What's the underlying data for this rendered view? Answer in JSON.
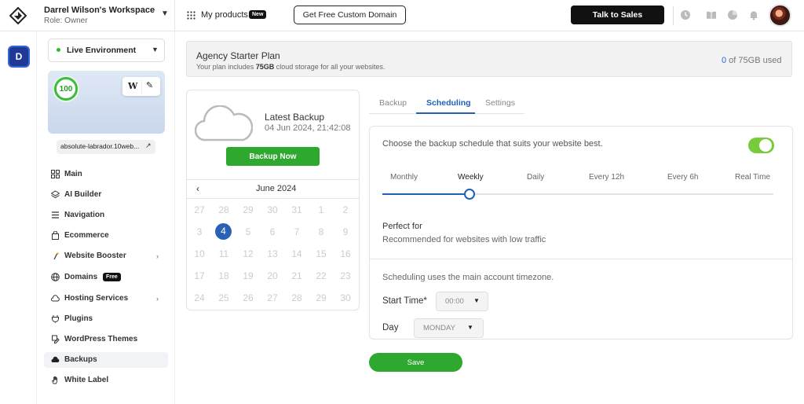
{
  "workspace": {
    "title": "Darrel Wilson's Workspace",
    "role": "Role: Owner"
  },
  "header": {
    "my_products": "My products",
    "new_badge": "New",
    "custom_domain": "Get Free Custom Domain",
    "talk_to_sales": "Talk to Sales"
  },
  "rail": {
    "workspace_initial": "D"
  },
  "sidebar": {
    "environment": "Live Environment",
    "score": "100",
    "wp_letter": "W",
    "site_name": "absolute-labrador.10web...",
    "free_badge": "Free",
    "items": [
      {
        "label": "Main",
        "icon": "grid-icon"
      },
      {
        "label": "AI Builder",
        "icon": "layers-icon"
      },
      {
        "label": "Navigation",
        "icon": "menu-icon"
      },
      {
        "label": "Ecommerce",
        "icon": "bag-icon"
      },
      {
        "label": "Website Booster",
        "icon": "sparkle-icon",
        "chevron": true
      },
      {
        "label": "Domains",
        "icon": "globe-icon"
      },
      {
        "label": "Hosting Services",
        "icon": "cloud-icon",
        "chevron": true
      },
      {
        "label": "Plugins",
        "icon": "plug-icon"
      },
      {
        "label": "WordPress Themes",
        "icon": "brush-icon"
      },
      {
        "label": "Backups",
        "icon": "cloud-filled-icon",
        "active": true
      },
      {
        "label": "White Label",
        "icon": "hand-icon"
      }
    ]
  },
  "plan": {
    "title": "Agency Starter Plan",
    "desc_prefix": "Your plan includes ",
    "desc_strong": "75GB",
    "desc_suffix": " cloud storage for all your websites.",
    "used_num": "0",
    "used_rest": " of 75GB used"
  },
  "backup": {
    "title": "Latest Backup",
    "date": "04 Jun 2024, 21:42:08",
    "button": "Backup Now"
  },
  "calendar": {
    "month": "June 2024",
    "selected": "4",
    "rows": [
      [
        "27",
        "28",
        "29",
        "30",
        "31",
        "1",
        "2"
      ],
      [
        "3",
        "4",
        "5",
        "6",
        "7",
        "8",
        "9"
      ],
      [
        "10",
        "11",
        "12",
        "13",
        "14",
        "15",
        "16"
      ],
      [
        "17",
        "18",
        "19",
        "20",
        "21",
        "22",
        "23"
      ],
      [
        "24",
        "25",
        "26",
        "27",
        "28",
        "29",
        "30"
      ]
    ]
  },
  "tabs": [
    "Backup",
    "Scheduling",
    "Settings"
  ],
  "schedule": {
    "description": "Choose the backup schedule that suits your website best.",
    "toggle_on": true,
    "frequencies": [
      "Monthly",
      "Weekly",
      "Daily",
      "Every 12h",
      "Every 6h",
      "Real Time"
    ],
    "selected_frequency": "Weekly",
    "perfect_for_title": "Perfect for",
    "perfect_for_desc": "Recommended for websites with low traffic",
    "timezone_note": "Scheduling uses the main account timezone.",
    "start_time_label": "Start Time*",
    "start_time_value": "00:00",
    "day_label": "Day",
    "day_value": "MONDAY",
    "save": "Save"
  },
  "colors": {
    "accent_blue": "#2060b8",
    "green": "#2ea82e",
    "toggle_green": "#7acb3c"
  }
}
